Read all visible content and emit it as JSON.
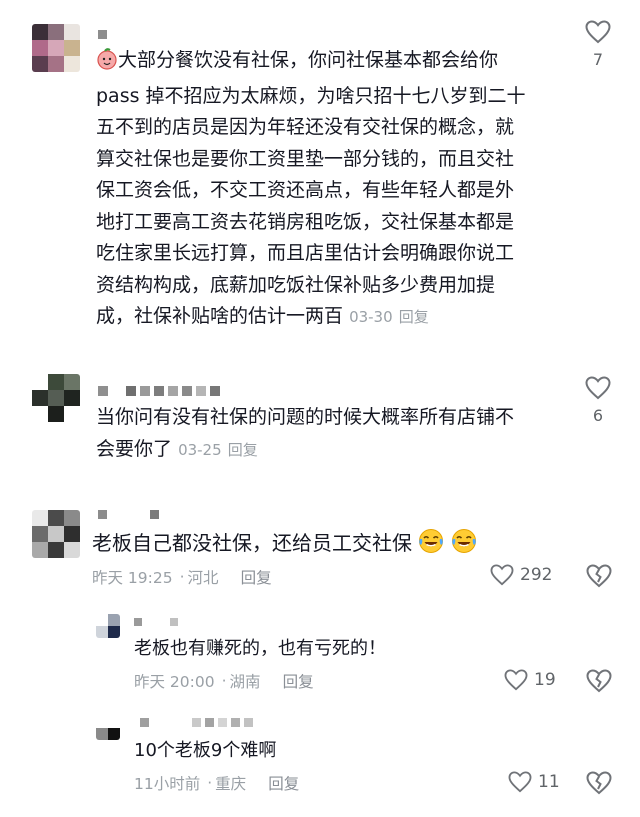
{
  "comments": [
    {
      "text_lines": [
        "大部分餐饮没有社保，你问社保基本都会给你",
        "pass 掉不招应为太麻烦，为啥只招十七八岁到二十",
        "五不到的店员是因为年轻还没有交社保的概念，就",
        "算交社保也是要你工资里垫一部分钱的，而且交社",
        "保工资会低，不交工资还高点，有些年轻人都是外",
        "地打工要高工资去花销房租吃饭，交社保基本都是",
        "吃住家里长远打算，而且店里估计会明确跟你说工",
        "资结构构成，底薪加吃饭社保补贴多少费用加提"
      ],
      "last_line": "成，社保补贴啥的估计一两百",
      "date": "03-30",
      "reply_label": "回复",
      "likes": "7"
    },
    {
      "text_lines": [
        "当你问有没有社保的问题的时候大概率所有店铺不"
      ],
      "last_line": "会要你了",
      "date": "03-25",
      "reply_label": "回复",
      "likes": "6"
    },
    {
      "text": "老板自己都没社保，还给员工交社保",
      "time": "昨天 19:25",
      "location": "河北",
      "reply_label": "回复",
      "likes": "292"
    }
  ],
  "replies": [
    {
      "text": "老板也有赚死的，也有亏死的！",
      "time": "昨天 20:00",
      "location": "湖南",
      "reply_label": "回复",
      "likes": "19"
    },
    {
      "text": "10个老板9个难啊",
      "time": "11小时前",
      "location": "重庆",
      "reply_label": "回复",
      "likes": "11"
    }
  ],
  "separator": "·",
  "icons": {
    "like": "heart-outline-icon",
    "dislike": "broken-heart-icon",
    "sticker": "peach-face-sticker-icon",
    "emoji": "face-with-tears-of-joy-icon"
  },
  "colors": {
    "text": "#161823",
    "meta": "#9aa0a6",
    "icon": "#707378"
  }
}
